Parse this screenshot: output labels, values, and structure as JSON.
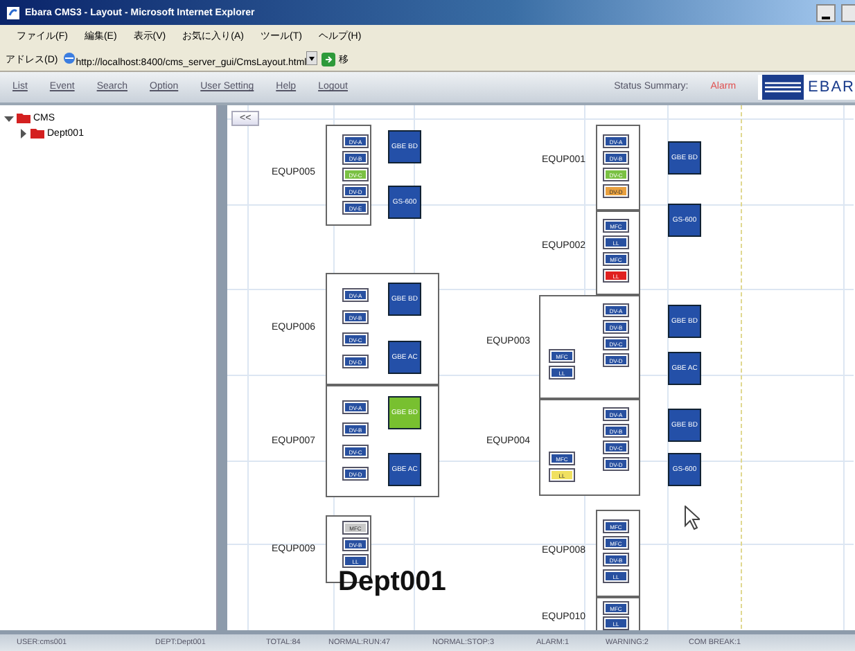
{
  "window": {
    "title": "Ebara CMS3 - Layout - Microsoft Internet Explorer"
  },
  "menu": [
    "ファイル(F)",
    "編集(E)",
    "表示(V)",
    "お気に入り(A)",
    "ツール(T)",
    "ヘルプ(H)"
  ],
  "address": {
    "label": "アドレス(D)",
    "value": "http://localhost:8400/cms_server_gui/CmsLayout.html",
    "go": "移"
  },
  "nav": {
    "links": [
      "List",
      "Event",
      "Search",
      "Option",
      "User Setting",
      "Help",
      "Logout"
    ],
    "status_label": "Status Summary:",
    "status_value": "Alarm",
    "logo": "EBAR"
  },
  "tree": {
    "items": [
      {
        "label": "CMS",
        "expanded": true,
        "children": [
          {
            "label": "Dept001",
            "expanded": false
          }
        ]
      }
    ]
  },
  "canvas": {
    "collapse": "<<",
    "department": "Dept001",
    "equipment": [
      {
        "name": "EQUP005",
        "chips": [
          {
            "label": "DV-A",
            "color": "#2850a0"
          },
          {
            "label": "DV-B",
            "color": "#2850a0"
          },
          {
            "label": "DV-C",
            "color": "#7ac143"
          },
          {
            "label": "DV-D",
            "color": "#2850a0"
          },
          {
            "label": "DV-E",
            "color": "#2850a0"
          }
        ],
        "units": [
          {
            "label": "GBE BD",
            "color": "#2450a8"
          },
          {
            "label": "GS-600",
            "color": "#2450a8"
          }
        ]
      },
      {
        "name": "EQUP001",
        "chips": [
          {
            "label": "DV-A",
            "color": "#2850a0"
          },
          {
            "label": "DV-B",
            "color": "#2850a0"
          },
          {
            "label": "DV-C",
            "color": "#7ac143"
          },
          {
            "label": "DV-D",
            "color": "#e8a040"
          }
        ],
        "units": [
          {
            "label": "GBE BD",
            "color": "#2450a8"
          }
        ]
      },
      {
        "name": "EQUP002",
        "chips": [
          {
            "label": "MFC",
            "color": "#2850a0"
          },
          {
            "label": "LL",
            "color": "#2850a0"
          },
          {
            "label": "MFC",
            "color": "#2850a0"
          },
          {
            "label": "LL",
            "color": "#e02020"
          }
        ],
        "units": [
          {
            "label": "GS-600",
            "color": "#2450a8"
          }
        ]
      },
      {
        "name": "EQUP006",
        "chips": [
          {
            "label": "DV-A",
            "color": "#2850a0"
          },
          {
            "label": "DV-B",
            "color": "#2850a0"
          },
          {
            "label": "DV-C",
            "color": "#2850a0"
          },
          {
            "label": "DV-D",
            "color": "#2850a0"
          }
        ],
        "units": [
          {
            "label": "GBE BD",
            "color": "#2450a8"
          },
          {
            "label": "GBE AC",
            "color": "#2450a8"
          }
        ]
      },
      {
        "name": "EQUP003",
        "chips": [
          {
            "label": "DV-A",
            "color": "#2850a0"
          },
          {
            "label": "DV-B",
            "color": "#2850a0"
          },
          {
            "label": "DV-C",
            "color": "#2850a0"
          },
          {
            "label": "DV-D",
            "color": "#2850a0"
          }
        ],
        "side_chips": [
          {
            "label": "MFC",
            "color": "#2850a0"
          },
          {
            "label": "LL",
            "color": "#2850a0"
          }
        ],
        "units": [
          {
            "label": "GBE BD",
            "color": "#2450a8"
          },
          {
            "label": "GBE AC",
            "color": "#2450a8"
          }
        ]
      },
      {
        "name": "EQUP007",
        "chips": [
          {
            "label": "DV-A",
            "color": "#2850a0"
          },
          {
            "label": "DV-B",
            "color": "#2850a0"
          },
          {
            "label": "DV-C",
            "color": "#2850a0"
          },
          {
            "label": "DV-D",
            "color": "#2850a0"
          }
        ],
        "units": [
          {
            "label": "GBE BD",
            "color": "#78c030"
          },
          {
            "label": "GBE AC",
            "color": "#2450a8"
          }
        ]
      },
      {
        "name": "EQUP004",
        "chips": [
          {
            "label": "DV-A",
            "color": "#2850a0"
          },
          {
            "label": "DV-B",
            "color": "#2850a0"
          },
          {
            "label": "DV-C",
            "color": "#2850a0"
          },
          {
            "label": "DV-D",
            "color": "#2850a0"
          }
        ],
        "side_chips": [
          {
            "label": "MFC",
            "color": "#2850a0"
          },
          {
            "label": "LL",
            "color": "#f0e060"
          }
        ],
        "units": [
          {
            "label": "GBE BD",
            "color": "#2450a8"
          },
          {
            "label": "GS-600",
            "color": "#2450a8"
          }
        ]
      },
      {
        "name": "EQUP009",
        "chips": [
          {
            "label": "MFC",
            "color": "#c8c8c8"
          },
          {
            "label": "DV-B",
            "color": "#2850a0"
          },
          {
            "label": "LL",
            "color": "#2850a0"
          }
        ]
      },
      {
        "name": "EQUP008",
        "chips": [
          {
            "label": "MFC",
            "color": "#2850a0"
          },
          {
            "label": "MFC",
            "color": "#2850a0"
          },
          {
            "label": "DV-B",
            "color": "#2850a0"
          },
          {
            "label": "LL",
            "color": "#2850a0"
          }
        ]
      },
      {
        "name": "EQUP010",
        "chips": [
          {
            "label": "MFC",
            "color": "#2850a0"
          },
          {
            "label": "LL",
            "color": "#2850a0"
          }
        ]
      }
    ]
  },
  "status_bar": [
    "USER:cms001",
    "DEPT:Dept001",
    "TOTAL:84",
    "NORMAL:RUN:47",
    "NORMAL:STOP:3",
    "ALARM:1",
    "WARNING:2",
    "COM BREAK:1"
  ]
}
